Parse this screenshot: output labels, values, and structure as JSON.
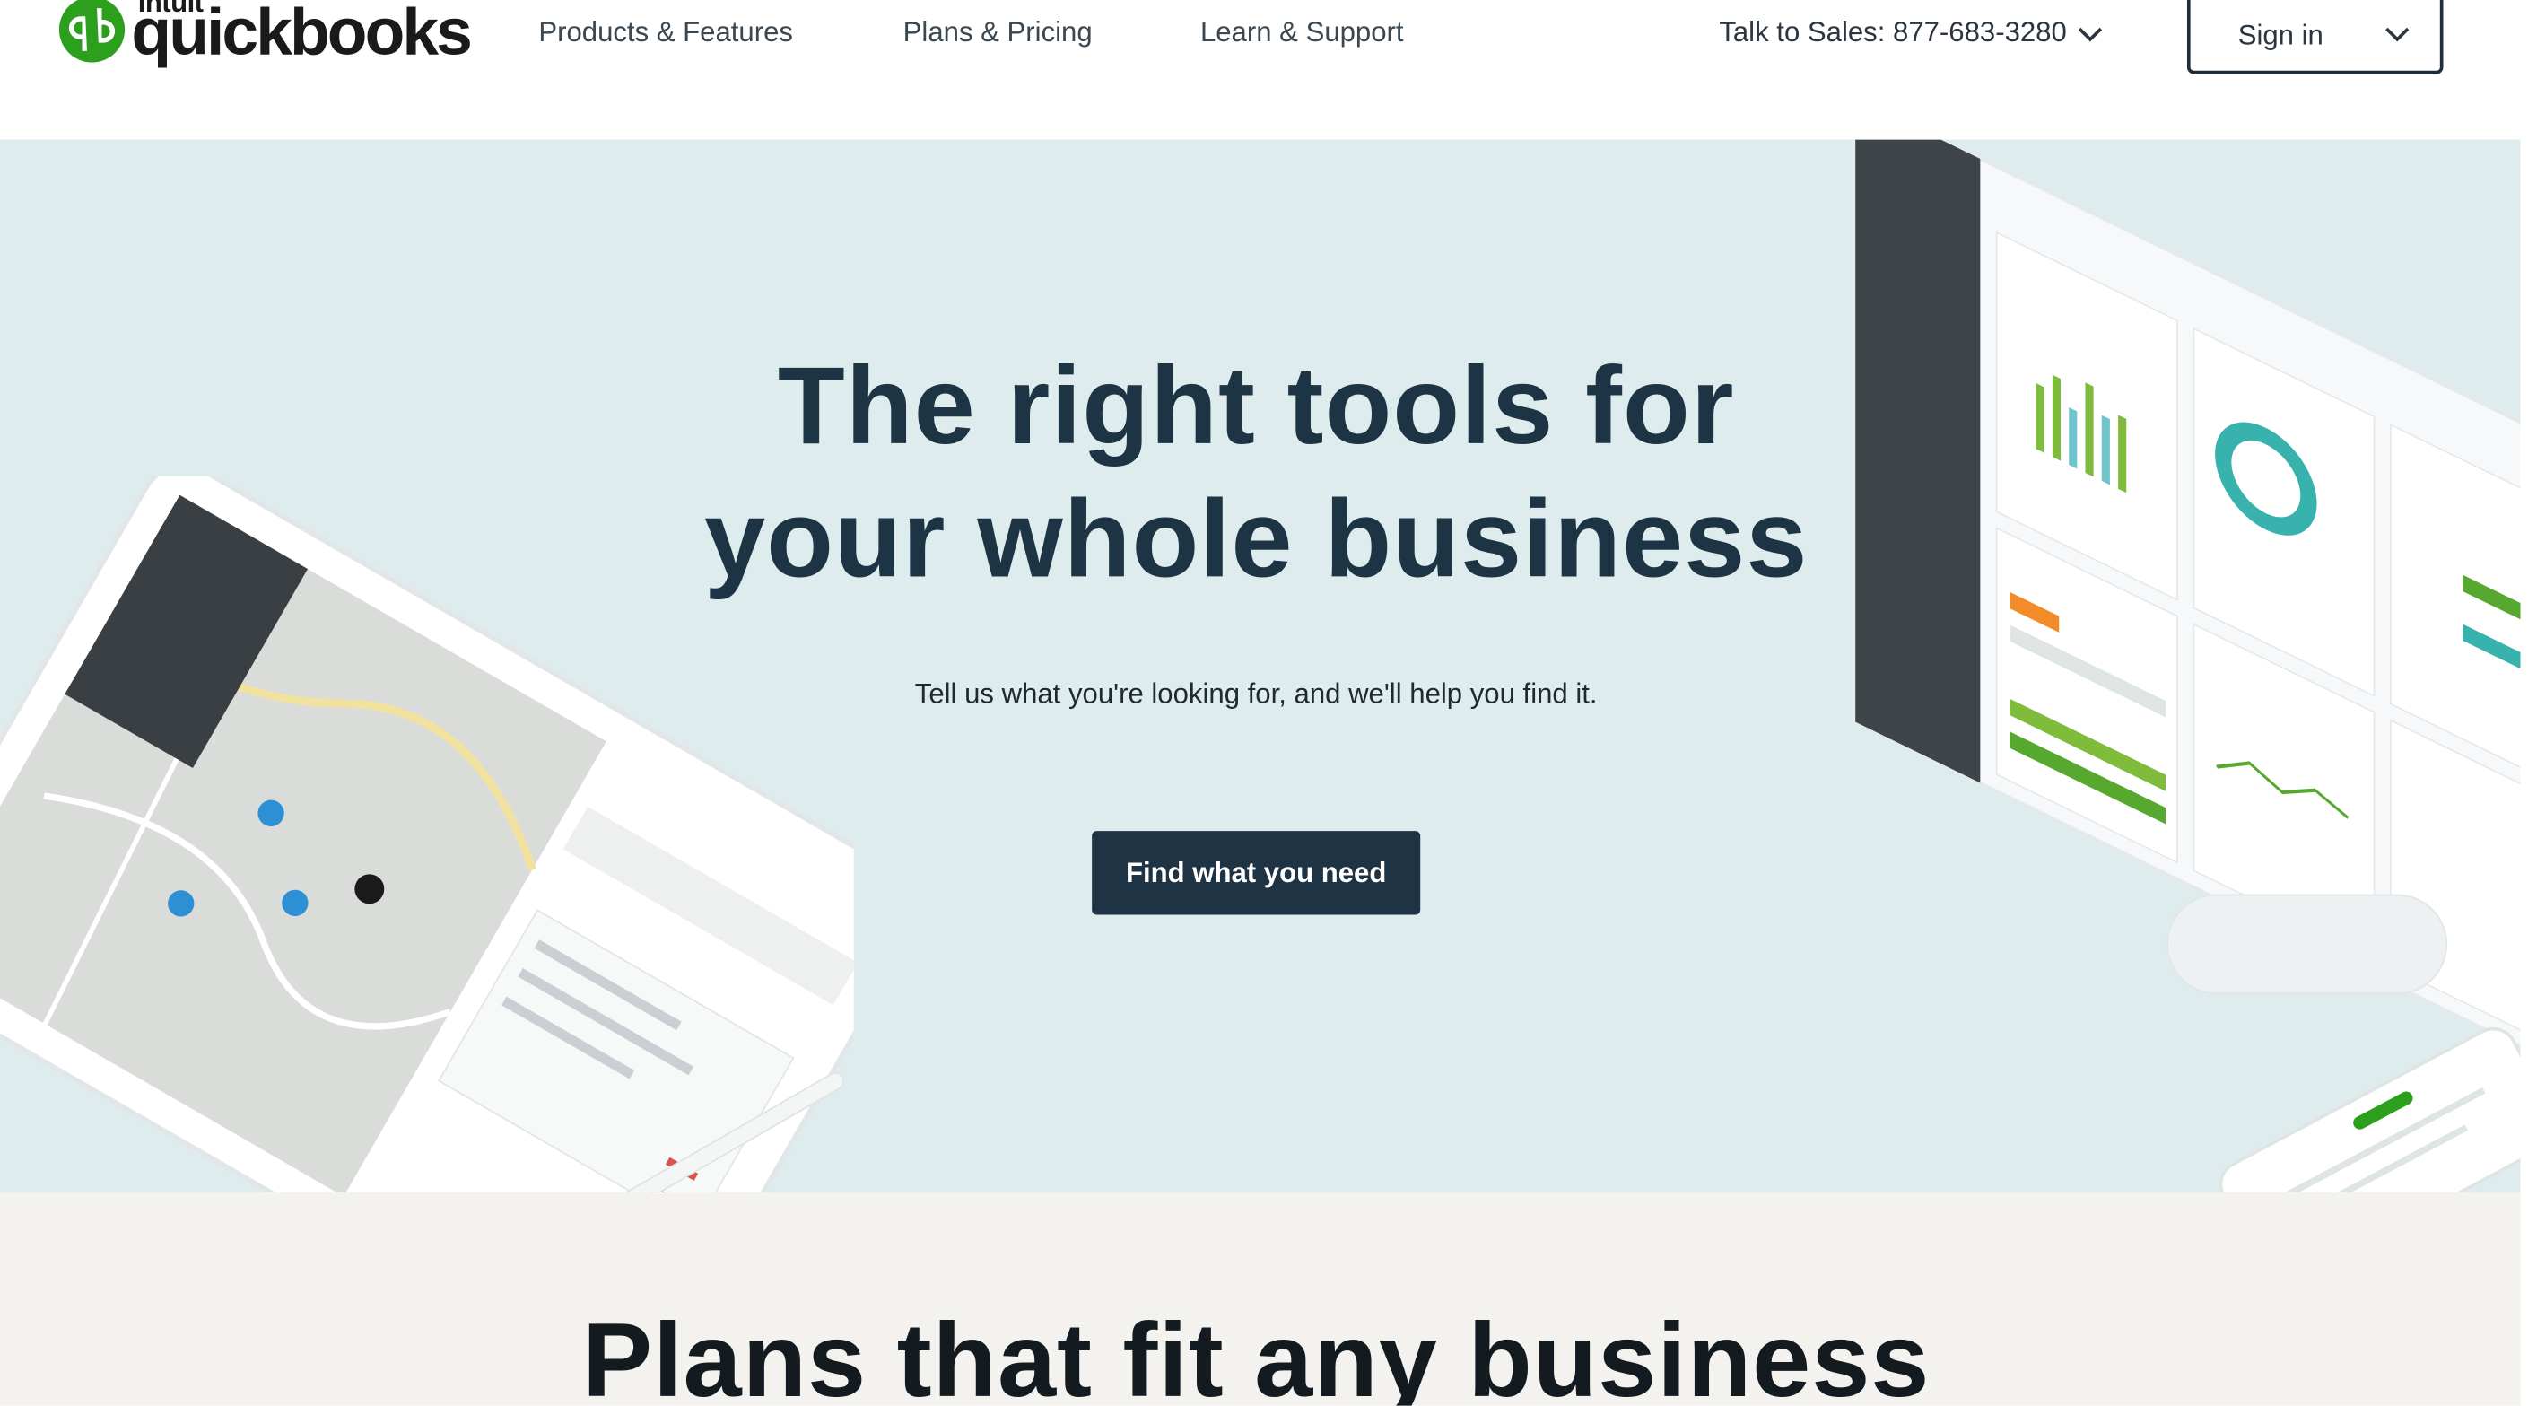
{
  "header": {
    "logo": {
      "intuit": "intuit",
      "wordmark": "quickbooks"
    },
    "nav": [
      {
        "label": "Products & Features"
      },
      {
        "label": "Plans & Pricing"
      },
      {
        "label": "Learn & Support"
      }
    ],
    "sales": "Talk to Sales: 877-683-3280",
    "signin": "Sign in"
  },
  "hero": {
    "title_line1": "The right tools for",
    "title_line2": "your whole business",
    "subtitle": "Tell us what you're looking for, and we'll help you find it.",
    "cta": "Find what you need"
  },
  "plans": {
    "title": "Plans that fit any business"
  },
  "colors": {
    "hero_bg": "#dfecee",
    "brand_green": "#2ca01c",
    "cta_bg": "#1e3343",
    "plans_bg": "#f3f2ef"
  }
}
